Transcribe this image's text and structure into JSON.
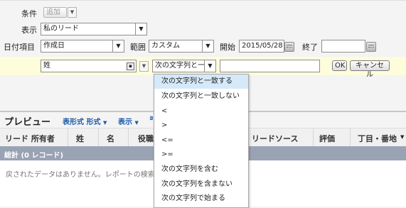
{
  "filters": {
    "condition_label": "条件",
    "add_label": "追加",
    "display_label": "表示",
    "display_value": "私のリード",
    "date_item_label": "日付項目",
    "date_item_value": "作成日",
    "range_label": "範囲",
    "range_value": "カスタム",
    "start_label": "開始",
    "start_value": "2015/05/28",
    "end_label": "終了",
    "end_value": ""
  },
  "filter_row": {
    "field_value": "姓",
    "operator_value": "次の文字列と一",
    "value_input": "",
    "ok_label": "OK",
    "cancel_label": "キャンセル"
  },
  "preview": {
    "title": "プレビュー",
    "format_label": "表形式 形式",
    "show_label": "表示",
    "extra": "ª"
  },
  "columns": [
    "リード 所有者",
    "姓",
    "名",
    "役職",
    "リードソース",
    "評価",
    "丁目・番地"
  ],
  "total_label": "総計 (0 レコード)",
  "empty_message": "戻されたデータはありません。レポートの検索",
  "operator_menu": [
    "次の文字列と一致する",
    "次の文字列と一致しない",
    "<",
    ">",
    "<=",
    ">=",
    "次の文字列を含む",
    "次の文字列を含まない",
    "次の文字列で始まる"
  ],
  "colors": {
    "filter_row_bg": "#fdfddc",
    "total_row_bg": "#9aa3b4",
    "link_blue": "#1c5ba8",
    "menu_selected": "#d6e9f8"
  }
}
